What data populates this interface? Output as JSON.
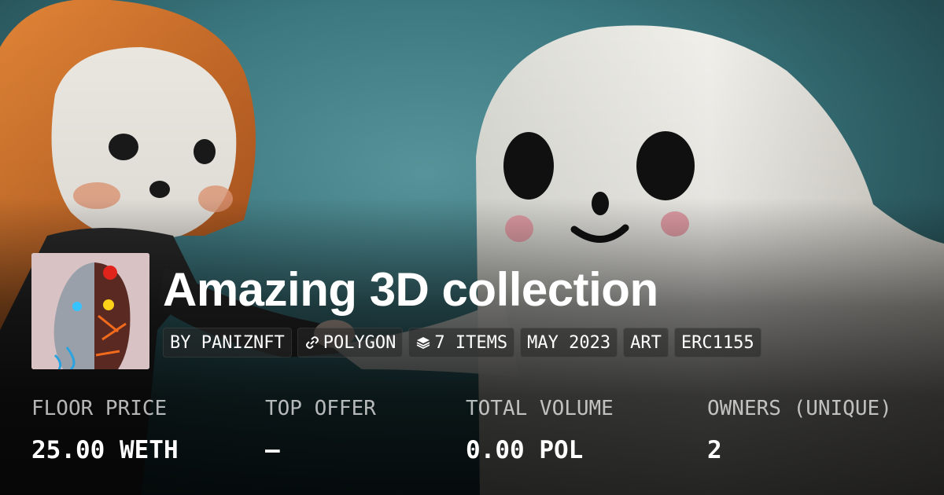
{
  "collection": {
    "title": "Amazing 3D collection",
    "avatar_alt": "collection avatar"
  },
  "tags": [
    {
      "label": "BY PANIZNFT",
      "icon": ""
    },
    {
      "label": "POLYGON",
      "icon": "chain-link-icon"
    },
    {
      "label": "7 ITEMS",
      "icon": "layers-icon"
    },
    {
      "label": "MAY 2023",
      "icon": ""
    },
    {
      "label": "ART",
      "icon": ""
    },
    {
      "label": "ERC1155",
      "icon": ""
    }
  ],
  "stats": [
    {
      "label": "FLOOR PRICE",
      "value": "25.00 WETH"
    },
    {
      "label": "TOP OFFER",
      "value": "–"
    },
    {
      "label": "TOTAL VOLUME",
      "value": "0.00 POL"
    },
    {
      "label": "OWNERS (UNIQUE)",
      "value": "2"
    }
  ],
  "colors": {
    "background": "#3d7a82",
    "text": "#ffffff",
    "muted_text": "#b3b3b3"
  }
}
